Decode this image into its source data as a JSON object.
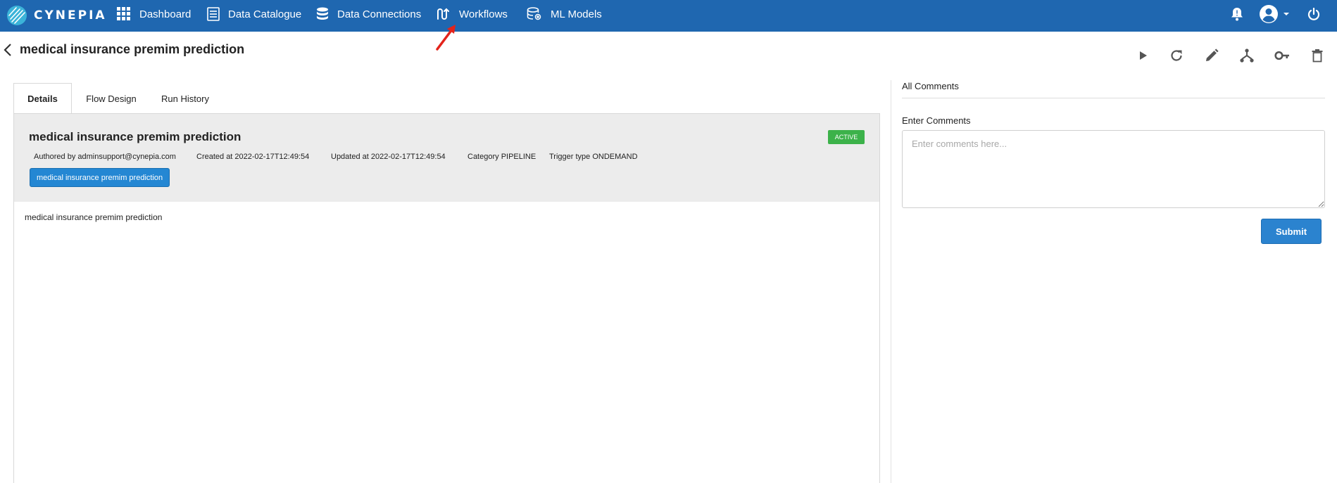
{
  "nav": {
    "brand": "CYNEPIA",
    "items": [
      {
        "label": "Dashboard",
        "icon": "grid-icon"
      },
      {
        "label": "Data Catalogue",
        "icon": "catalogue-icon"
      },
      {
        "label": "Data Connections",
        "icon": "database-icon"
      },
      {
        "label": "Workflows",
        "icon": "workflow-icon"
      },
      {
        "label": "ML Models",
        "icon": "ml-models-icon"
      }
    ],
    "right_icons": [
      "bell-icon",
      "account-icon",
      "power-icon"
    ]
  },
  "header": {
    "title": "medical insurance premim prediction",
    "actions": [
      "play-icon",
      "refresh-icon",
      "edit-icon",
      "fork-icon",
      "key-icon",
      "trash-icon"
    ]
  },
  "tabs": [
    "Details",
    "Flow Design",
    "Run History"
  ],
  "details": {
    "title": "medical insurance premim prediction",
    "status": "ACTIVE",
    "authored": "Authored by adminsupport@cynepia.com",
    "created": "Created at 2022-02-17T12:49:54",
    "updated": "Updated at 2022-02-17T12:49:54",
    "category": "Category PIPELINE",
    "trigger": "Trigger type ONDEMAND",
    "tag": "medical insurance premim prediction",
    "description": "medical insurance premim prediction"
  },
  "comments": {
    "title": "All Comments",
    "label": "Enter Comments",
    "placeholder": "Enter comments here...",
    "submit": "Submit"
  },
  "colors": {
    "nav_bg": "#1f67b0",
    "active_badge": "#3cb24a",
    "primary_button": "#2b83cf",
    "annotation_arrow": "#e3231b"
  }
}
